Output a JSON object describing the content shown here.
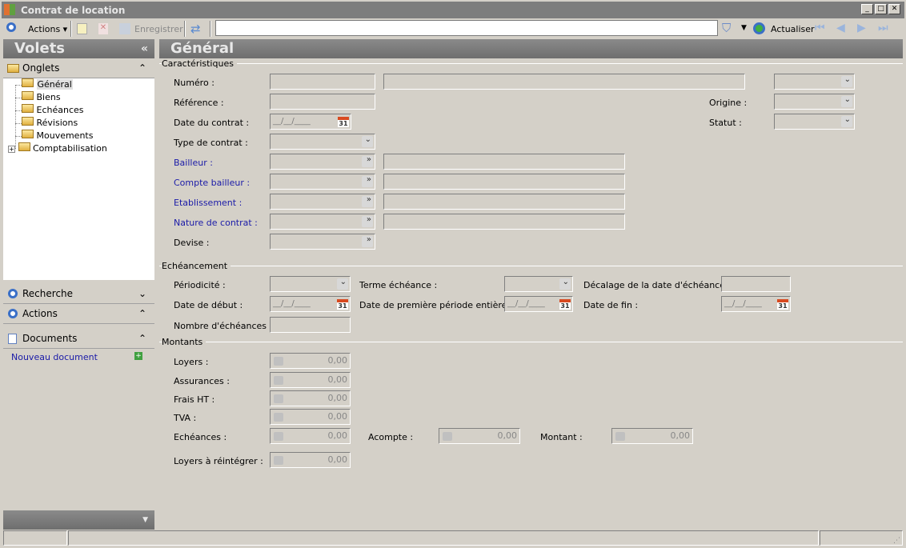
{
  "window": {
    "title": "Contrat de location"
  },
  "toolbar": {
    "actions": "Actions",
    "save": "Enregistrer",
    "search_value": "",
    "refresh": "Actualiser"
  },
  "left": {
    "title": "Volets",
    "collapse": "«",
    "tabs_header": "Onglets",
    "tree": [
      "Général",
      "Biens",
      "Echéances",
      "Révisions",
      "Mouvements",
      "Comptabilisation"
    ],
    "search": "Recherche",
    "actions": "Actions",
    "documents": "Documents",
    "new_doc": "Nouveau document"
  },
  "main": {
    "title": "Général",
    "carac": {
      "title": "Caractéristiques",
      "numero": "Numéro :",
      "reference": "Référence :",
      "origine": "Origine :",
      "date": "Date du contrat :",
      "statut": "Statut :",
      "type": "Type de contrat :",
      "bailleur": "Bailleur :",
      "compte": "Compte bailleur :",
      "etab": "Etablissement :",
      "nature": "Nature de contrat :",
      "devise": "Devise :",
      "date_mask": "__/__/____"
    },
    "ech": {
      "title": "Echéancement",
      "periodicite": "Périodicité :",
      "terme": "Terme échéance :",
      "decalage": "Décalage de la date d'échéance :",
      "debut": "Date de début :",
      "premiere": "Date de première période entière :",
      "fin": "Date de fin :",
      "nombre": "Nombre d'échéances :"
    },
    "montants": {
      "title": "Montants",
      "loyers": "Loyers :",
      "assurances": "Assurances :",
      "frais": "Frais HT :",
      "tva": "TVA :",
      "echeances": "Echéances :",
      "acompte": "Acompte :",
      "montant": "Montant :",
      "reintegrer": "Loyers à réintégrer :",
      "zero": "0,00"
    }
  }
}
